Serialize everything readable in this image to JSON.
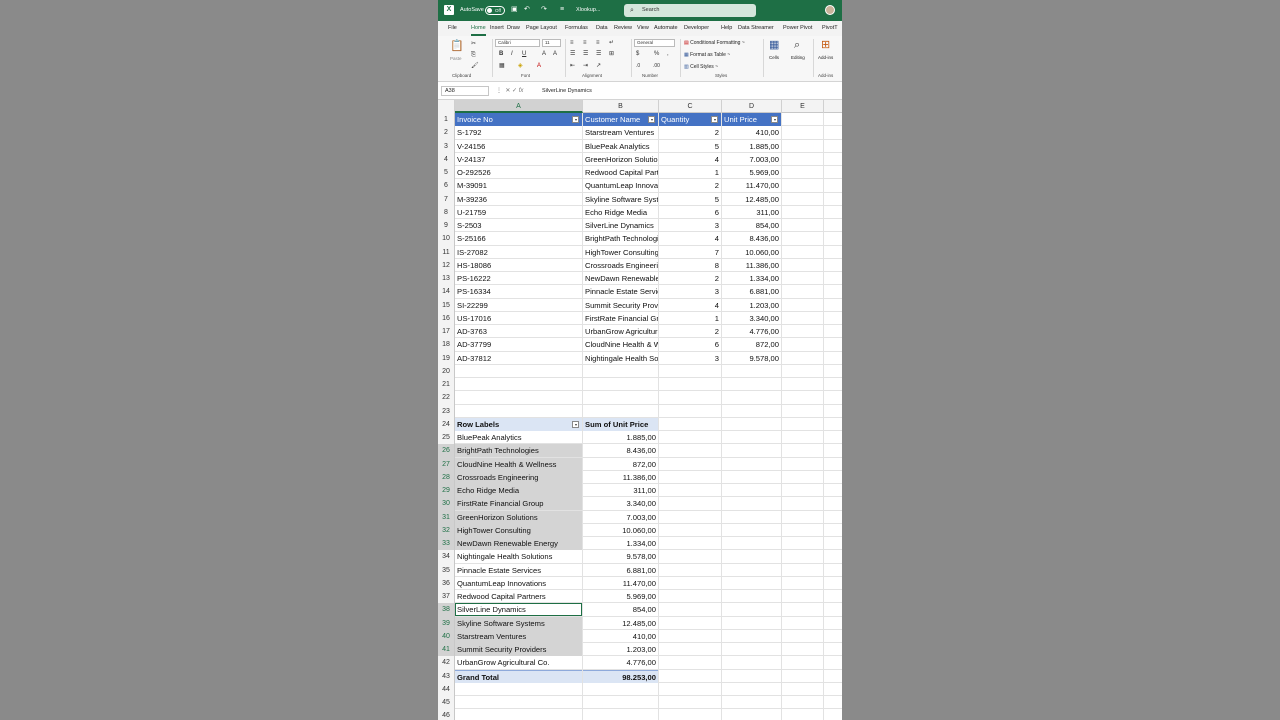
{
  "titlebar": {
    "autosave_label": "AutoSave",
    "autosave_state": "Off",
    "filename": "Xlookup...",
    "search_placeholder": "Search"
  },
  "tabs": [
    "File",
    "Home",
    "Insert",
    "Draw",
    "Page Layout",
    "Formulas",
    "Data",
    "Review",
    "View",
    "Automate",
    "Developer",
    "Help",
    "Data Streamer",
    "Power Pivot",
    "PivotT"
  ],
  "active_tab": "Home",
  "ribbon": {
    "font_name": "Calibri",
    "font_size": "11",
    "number_format": "General",
    "conditional_formatting": "Conditional Formatting ~",
    "format_as_table": "Format as Table ~",
    "cell_styles": "Cell Styles ~",
    "cells": "Cells",
    "editing": "Editing",
    "addins": "Add-ins",
    "paste": "Paste",
    "groups": {
      "clipboard": "Clipboard",
      "font": "Font",
      "alignment": "Alignment",
      "number": "Number",
      "styles": "Styles",
      "addins": "Add-ins"
    }
  },
  "formula_bar": {
    "name_box": "A38",
    "content": "SilverLine Dynamics"
  },
  "columns": [
    "A",
    "B",
    "C",
    "D",
    "E"
  ],
  "table": {
    "headers": [
      "Invoice No",
      "Customer Name",
      "Quantity",
      "Unit Price"
    ],
    "rows": [
      [
        "S-1792",
        "Starstream Ventures",
        "2",
        "410,00"
      ],
      [
        "V-24156",
        "BluePeak Analytics",
        "5",
        "1.885,00"
      ],
      [
        "V-24137",
        "GreenHorizon Solutions",
        "4",
        "7.003,00"
      ],
      [
        "O-292526",
        "Redwood Capital Partners",
        "1",
        "5.969,00"
      ],
      [
        "M-39091",
        "QuantumLeap Innovations",
        "2",
        "11.470,00"
      ],
      [
        "M-39236",
        "Skyline Software Systems",
        "5",
        "12.485,00"
      ],
      [
        "U-21759",
        "Echo Ridge Media",
        "6",
        "311,00"
      ],
      [
        "S-2503",
        "SilverLine Dynamics",
        "3",
        "854,00"
      ],
      [
        "S-25166",
        "BrightPath Technologies",
        "4",
        "8.436,00"
      ],
      [
        "IS-27082",
        "HighTower Consulting",
        "7",
        "10.060,00"
      ],
      [
        "HS-18086",
        "Crossroads Engineering",
        "8",
        "11.386,00"
      ],
      [
        "PS-16222",
        "NewDawn Renewable Energy",
        "2",
        "1.334,00"
      ],
      [
        "PS-16334",
        "Pinnacle Estate Services",
        "3",
        "6.881,00"
      ],
      [
        "SI-22299",
        "Summit Security Providers",
        "4",
        "1.203,00"
      ],
      [
        "US-17016",
        "FirstRate Financial Group",
        "1",
        "3.340,00"
      ],
      [
        "AD-3763",
        "UrbanGrow Agricultural Co.",
        "2",
        "4.776,00"
      ],
      [
        "AD-37799",
        "CloudNine Health & Wellness",
        "6",
        "872,00"
      ],
      [
        "AD-37812",
        "Nightingale Health Solutions",
        "3",
        "9.578,00"
      ]
    ]
  },
  "pivot": {
    "row_labels_header": "Row Labels",
    "value_header": "Sum of Unit Price",
    "rows": [
      [
        "BluePeak Analytics",
        "1.885,00"
      ],
      [
        "BrightPath Technologies",
        "8.436,00"
      ],
      [
        "CloudNine Health & Wellness",
        "872,00"
      ],
      [
        "Crossroads Engineering",
        "11.386,00"
      ],
      [
        "Echo Ridge Media",
        "311,00"
      ],
      [
        "FirstRate Financial Group",
        "3.340,00"
      ],
      [
        "GreenHorizon Solutions",
        "7.003,00"
      ],
      [
        "HighTower Consulting",
        "10.060,00"
      ],
      [
        "NewDawn Renewable Energy",
        "1.334,00"
      ],
      [
        "Nightingale Health Solutions",
        "9.578,00"
      ],
      [
        "Pinnacle Estate Services",
        "6.881,00"
      ],
      [
        "QuantumLeap Innovations",
        "11.470,00"
      ],
      [
        "Redwood Capital Partners",
        "5.969,00"
      ],
      [
        "SilverLine Dynamics",
        "854,00"
      ],
      [
        "Skyline Software Systems",
        "12.485,00"
      ],
      [
        "Starstream Ventures",
        "410,00"
      ],
      [
        "Summit Security Providers",
        "1.203,00"
      ],
      [
        "UrbanGrow Agricultural Co.",
        "4.776,00"
      ]
    ],
    "grand_total_label": "Grand Total",
    "grand_total_value": "98.253,00"
  },
  "row_numbers": [
    "1",
    "2",
    "3",
    "4",
    "5",
    "6",
    "7",
    "8",
    "9",
    "10",
    "11",
    "12",
    "13",
    "14",
    "15",
    "16",
    "17",
    "18",
    "19",
    "20",
    "21",
    "22",
    "23",
    "24",
    "25",
    "26",
    "27",
    "28",
    "29",
    "30",
    "31",
    "32",
    "33",
    "34",
    "35",
    "36",
    "37",
    "38",
    "39",
    "40",
    "41",
    "42",
    "43",
    "44",
    "45",
    "46"
  ],
  "colors": {
    "excel_green": "#1e6f45",
    "table_header": "#4472c4",
    "pivot_header": "#dbe5f4",
    "selection": "#d4d4d4"
  }
}
